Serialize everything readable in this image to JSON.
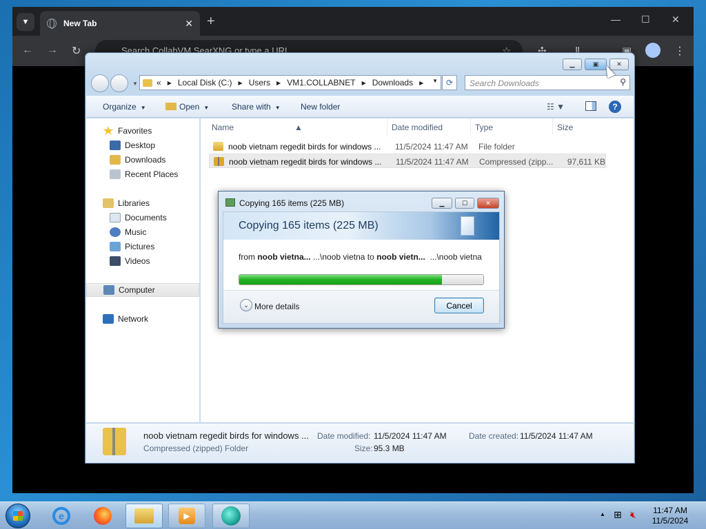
{
  "browser": {
    "tab_title": "New Tab",
    "omnibox_placeholder": "Search CollabVM SearXNG or type a URL"
  },
  "explorer": {
    "address": {
      "overflow": "«",
      "segments": [
        "Local Disk (C:)",
        "Users",
        "VM1.COLLABNET",
        "Downloads"
      ]
    },
    "search_placeholder": "Search Downloads",
    "commands": {
      "organize": "Organize",
      "open": "Open",
      "share_with": "Share with",
      "new_folder": "New folder"
    },
    "nav": {
      "favorites": "Favorites",
      "desktop": "Desktop",
      "downloads": "Downloads",
      "recent_places": "Recent Places",
      "libraries": "Libraries",
      "documents": "Documents",
      "music": "Music",
      "pictures": "Pictures",
      "videos": "Videos",
      "computer": "Computer",
      "network": "Network"
    },
    "columns": {
      "name": "Name",
      "date_modified": "Date modified",
      "type": "Type",
      "size": "Size"
    },
    "files": [
      {
        "name": "noob vietnam regedit birds for windows ...",
        "date": "11/5/2024 11:47 AM",
        "type": "File folder",
        "size": ""
      },
      {
        "name": "noob vietnam regedit birds for windows ...",
        "date": "11/5/2024 11:47 AM",
        "type": "Compressed (zipp...",
        "size": "97,611 KB"
      }
    ],
    "details": {
      "name": "noob vietnam regedit birds for windows ...",
      "type": "Compressed (zipped) Folder",
      "date_modified_label": "Date modified:",
      "date_modified": "11/5/2024 11:47 AM",
      "date_created_label": "Date created:",
      "date_created": "11/5/2024 11:47 AM",
      "size_label": "Size:",
      "size": "95.3 MB"
    }
  },
  "copy_dialog": {
    "title": "Copying 165 items (225 MB)",
    "heading": "Copying 165 items (225 MB)",
    "from_label": "from",
    "from_name": "noob vietna...",
    "from_path": "...\\noob vietna",
    "to_label": "to",
    "to_name": "noob vietn...",
    "to_path": "...\\noob vietna",
    "progress_fraction": 0.83,
    "more_details": "More details",
    "cancel": "Cancel"
  },
  "taskbar": {
    "time": "11:47 AM",
    "date": "11/5/2024"
  }
}
